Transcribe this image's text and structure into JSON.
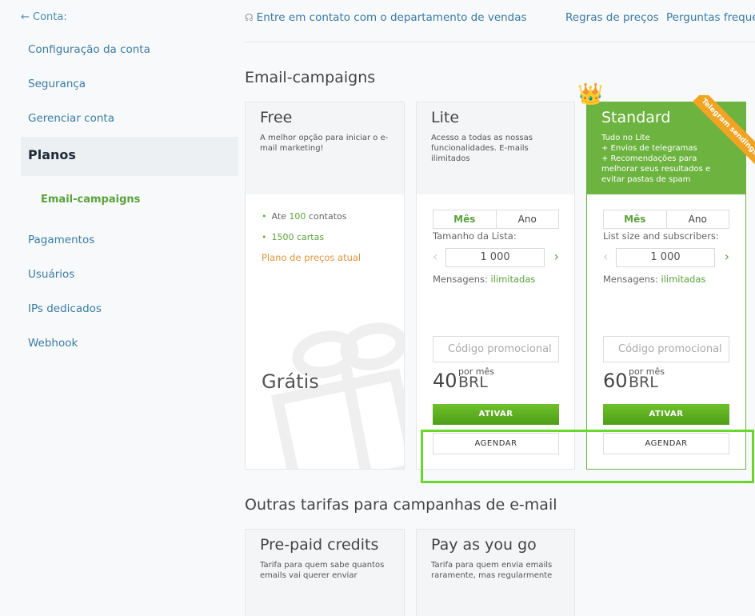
{
  "sidebar": {
    "back": "← Conta:",
    "items": [
      "Configuração da conta",
      "Segurança",
      "Gerenciar conta"
    ],
    "active": "Planos",
    "sub": "Email-campaigns",
    "items2": [
      "Pagamentos",
      "Usuários",
      "IPs dedicados",
      "Webhook"
    ]
  },
  "topbar": {
    "contact": "Entre em contato com o departamento de vendas",
    "pricing_rules": "Regras de preços",
    "faq": "Perguntas freque"
  },
  "section1_title": "Email-campaigns",
  "section2_title": "Outras tarifas para campanhas de e-mail",
  "free": {
    "title": "Free",
    "desc": "A melhor opção para iniciar o e-mail marketing!",
    "b1_pre": "Ate ",
    "b1_hl": "100",
    "b1_post": " contatos",
    "b2": "1500 cartas",
    "current": "Plano de preços atual",
    "price": "Grátis"
  },
  "lite": {
    "title": "Lite",
    "desc": "Acesso a todas as nossas funcionalidades. E-mails ilimitados",
    "month": "Mês",
    "year": "Ano",
    "size_label": "Tamanho da Lista:",
    "size_value": "1 000",
    "msgs_label": "Mensagens: ",
    "msgs_value": "ilimitadas",
    "promo_placeholder": "Código promocional",
    "price": "40",
    "per": "por mês",
    "currency": "BRL",
    "activate": "ATIVAR",
    "schedule": "AGENDAR"
  },
  "standard": {
    "title": "Standard",
    "desc_lines": [
      "Tudo no Lite",
      "+ Envios de telegramas",
      "+ Recomendações para",
      "melhorar seus resultados e",
      "evitar pastas de spam"
    ],
    "ribbon": "Telegram sendings",
    "month": "Mês",
    "year": "Ano",
    "size_label": "List size and subscribers:",
    "size_value": "1 000",
    "msgs_label": "Mensagens: ",
    "msgs_value": "ilimitadas",
    "promo_placeholder": "Código promocional",
    "price": "60",
    "per": "por mês",
    "currency": "BRL",
    "activate": "ATIVAR",
    "schedule": "AGENDAR"
  },
  "prepaid": {
    "title": "Pre-paid credits",
    "desc": "Tarifa para quem sabe quantos emails vai querer enviar"
  },
  "payg": {
    "title": "Pay as you go",
    "desc": "Tarifa para quem envia emails raramente, mas regularmente"
  },
  "colors": {
    "accent_green": "#6cb33f",
    "link_blue": "#3a7ca5",
    "orange": "#e8933a",
    "highlight": "#67d92d"
  }
}
